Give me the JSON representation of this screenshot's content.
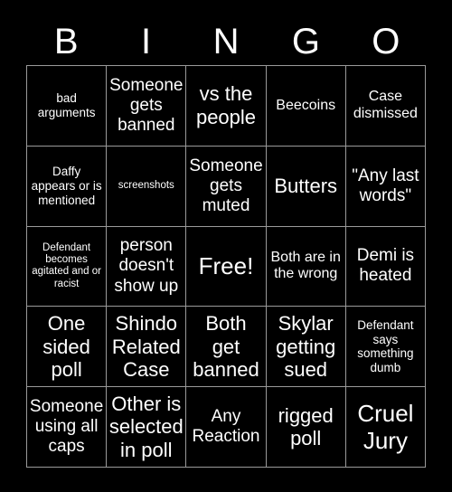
{
  "card": {
    "header_letters": [
      "B",
      "I",
      "N",
      "G",
      "O"
    ],
    "rows": [
      [
        {
          "text": "bad arguments",
          "size": "sm"
        },
        {
          "text": "Someone gets banned",
          "size": "lg"
        },
        {
          "text": "vs the people",
          "size": "xl"
        },
        {
          "text": "Beecoins",
          "size": "md"
        },
        {
          "text": "Case dismissed",
          "size": "md"
        }
      ],
      [
        {
          "text": "Daffy appears or is mentioned",
          "size": "sm"
        },
        {
          "text": "screenshots",
          "size": "xs"
        },
        {
          "text": "Someone gets muted",
          "size": "lg"
        },
        {
          "text": "Butters",
          "size": "xl"
        },
        {
          "text": "\"Any last words\"",
          "size": "lg"
        }
      ],
      [
        {
          "text": "Defendant becomes agitated and or racist",
          "size": "xs"
        },
        {
          "text": "person doesn't show up",
          "size": "lg"
        },
        {
          "text": "Free!",
          "size": "xxl"
        },
        {
          "text": "Both are in the wrong",
          "size": "md"
        },
        {
          "text": "Demi is heated",
          "size": "lg"
        }
      ],
      [
        {
          "text": "One sided poll",
          "size": "xl"
        },
        {
          "text": "Shindo Related Case",
          "size": "xl"
        },
        {
          "text": "Both get banned",
          "size": "xl"
        },
        {
          "text": "Skylar getting sued",
          "size": "xl"
        },
        {
          "text": "Defendant says something dumb",
          "size": "sm"
        }
      ],
      [
        {
          "text": "Someone using all caps",
          "size": "lg"
        },
        {
          "text": "Other is selected in poll",
          "size": "xl"
        },
        {
          "text": "Any Reaction",
          "size": "lg"
        },
        {
          "text": "rigged poll",
          "size": "xl"
        },
        {
          "text": "Cruel Jury",
          "size": "xxl"
        }
      ]
    ]
  },
  "colors": {
    "background": "#000000",
    "text": "#ffffff",
    "grid_line": "#9a9a9a"
  }
}
